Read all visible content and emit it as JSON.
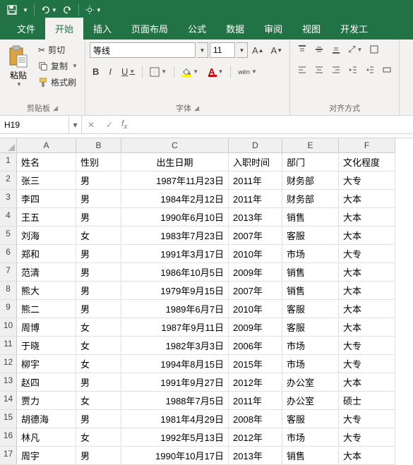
{
  "qat": {
    "save_tip": "保存",
    "undo_tip": "撤销",
    "redo_tip": "恢复"
  },
  "tabs": {
    "file": "文件",
    "home": "开始",
    "insert": "插入",
    "pagelayout": "页面布局",
    "formulas": "公式",
    "data": "数据",
    "review": "审阅",
    "view": "视图",
    "dev": "开发工"
  },
  "ribbon": {
    "clipboard": {
      "paste": "粘贴",
      "cut": "剪切",
      "copy": "复制",
      "formatpainter": "格式刷",
      "group": "剪贴板"
    },
    "font": {
      "name": "等线",
      "size": "11",
      "group": "字体",
      "ruby": "wén"
    },
    "align": {
      "group": "对齐方式"
    }
  },
  "namebox": "H19",
  "columns": [
    "A",
    "B",
    "C",
    "D",
    "E",
    "F"
  ],
  "headers": {
    "name": "姓名",
    "gender": "性别",
    "birth": "出生日期",
    "hire": "入职时间",
    "dept": "部门",
    "edu": "文化程度"
  },
  "rows": [
    {
      "n": "1"
    },
    {
      "n": "2",
      "name": "张三",
      "gender": "男",
      "birth": "1987年11月23日",
      "hire": "2011年",
      "dept": "财务部",
      "edu": "大专"
    },
    {
      "n": "3",
      "name": "李四",
      "gender": "男",
      "birth": "1984年2月12日",
      "hire": "2011年",
      "dept": "财务部",
      "edu": "大本"
    },
    {
      "n": "4",
      "name": "王五",
      "gender": "男",
      "birth": "1990年6月10日",
      "hire": "2013年",
      "dept": "销售",
      "edu": "大本"
    },
    {
      "n": "5",
      "name": "刘海",
      "gender": "女",
      "birth": "1983年7月23日",
      "hire": "2007年",
      "dept": "客服",
      "edu": "大本"
    },
    {
      "n": "6",
      "name": "郑和",
      "gender": "男",
      "birth": "1991年3月17日",
      "hire": "2010年",
      "dept": "市场",
      "edu": "大专"
    },
    {
      "n": "7",
      "name": "范清",
      "gender": "男",
      "birth": "1986年10月5日",
      "hire": "2009年",
      "dept": "销售",
      "edu": "大本"
    },
    {
      "n": "8",
      "name": "熊大",
      "gender": "男",
      "birth": "1979年9月15日",
      "hire": "2007年",
      "dept": "销售",
      "edu": "大本"
    },
    {
      "n": "9",
      "name": "熊二",
      "gender": "男",
      "birth": "1989年6月7日",
      "hire": "2010年",
      "dept": "客服",
      "edu": "大本"
    },
    {
      "n": "10",
      "name": "周博",
      "gender": "女",
      "birth": "1987年9月11日",
      "hire": "2009年",
      "dept": "客服",
      "edu": "大本"
    },
    {
      "n": "11",
      "name": "于晓",
      "gender": "女",
      "birth": "1982年3月3日",
      "hire": "2006年",
      "dept": "市场",
      "edu": "大专"
    },
    {
      "n": "12",
      "name": "柳宇",
      "gender": "女",
      "birth": "1994年8月15日",
      "hire": "2015年",
      "dept": "市场",
      "edu": "大专"
    },
    {
      "n": "13",
      "name": "赵四",
      "gender": "男",
      "birth": "1991年9月27日",
      "hire": "2012年",
      "dept": "办公室",
      "edu": "大本"
    },
    {
      "n": "14",
      "name": "贾力",
      "gender": "女",
      "birth": "1988年7月5日",
      "hire": "2011年",
      "dept": "办公室",
      "edu": "硕士"
    },
    {
      "n": "15",
      "name": "胡德海",
      "gender": "男",
      "birth": "1981年4月29日",
      "hire": "2008年",
      "dept": "客服",
      "edu": "大专"
    },
    {
      "n": "16",
      "name": "林凡",
      "gender": "女",
      "birth": "1992年5月13日",
      "hire": "2012年",
      "dept": "市场",
      "edu": "大专"
    },
    {
      "n": "17",
      "name": "周宇",
      "gender": "男",
      "birth": "1990年10月17日",
      "hire": "2013年",
      "dept": "销售",
      "edu": "大本"
    }
  ]
}
